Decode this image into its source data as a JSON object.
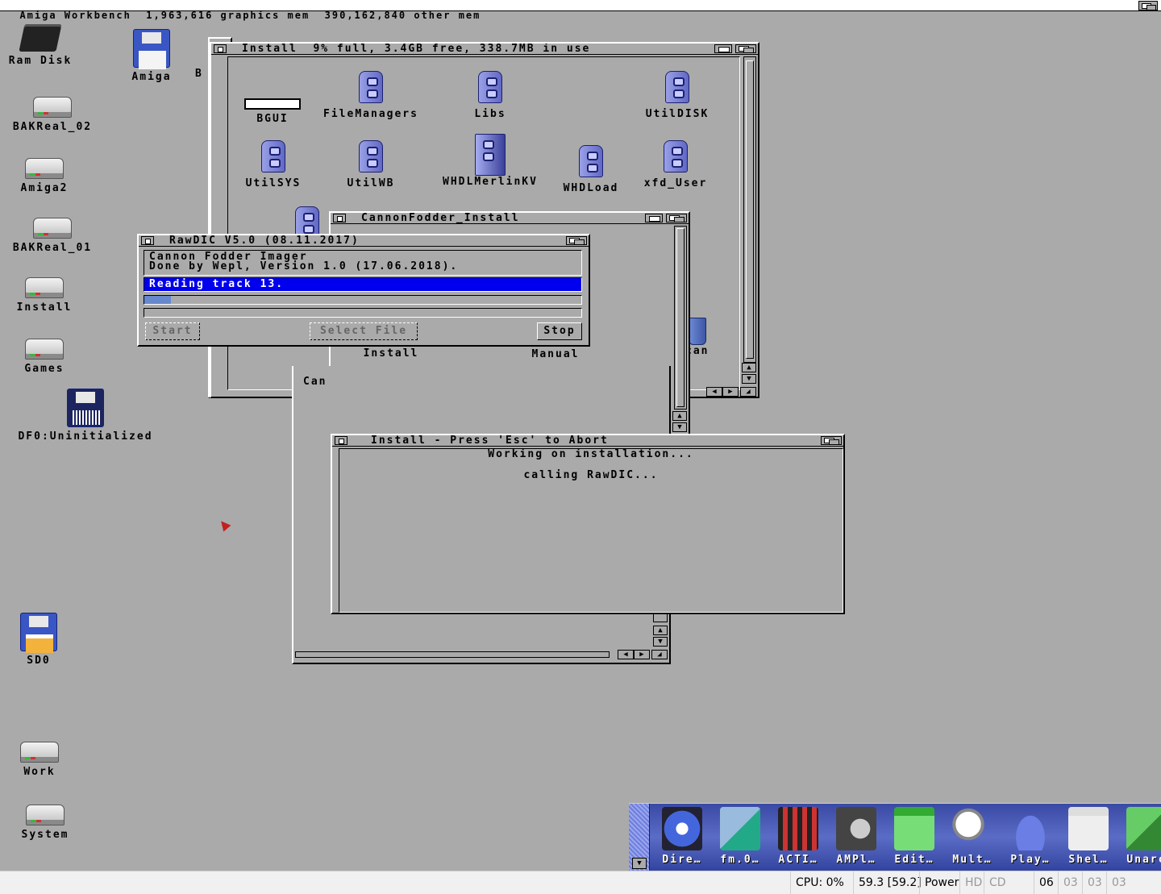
{
  "screen": {
    "title": "Amiga Workbench  1,963,616 graphics mem  390,162,840 other mem"
  },
  "desktop_icons": [
    {
      "label": "Ram Disk"
    },
    {
      "label": "Amiga"
    },
    {
      "label": "BAKReal_02"
    },
    {
      "label": "Amiga2"
    },
    {
      "label": "BAKReal_01"
    },
    {
      "label": "Install"
    },
    {
      "label": "Games"
    },
    {
      "label": "DF0:Uninitialized"
    },
    {
      "label": "SD0"
    },
    {
      "label": "Work"
    },
    {
      "label": "System"
    }
  ],
  "partial_icon_label": "B",
  "install_window": {
    "title": "Install  9% full, 3.4GB free, 338.7MB in use",
    "items": [
      {
        "label": "BGUI"
      },
      {
        "label": "FileManagers"
      },
      {
        "label": "Libs"
      },
      {
        "label": "UtilDISK"
      },
      {
        "label": "UtilSYS"
      },
      {
        "label": "UtilWB"
      },
      {
        "label": "WHDLMerlinKV"
      },
      {
        "label": "WHDLoad"
      },
      {
        "label": "xfd_User"
      }
    ],
    "partial_trashcan": "can"
  },
  "cannonfodder_window": {
    "title": "CannonFodder_Install",
    "items": [
      {
        "label": "Install"
      },
      {
        "label": "Manual"
      }
    ],
    "partial_label": "Can"
  },
  "rawdic_window": {
    "title": "RawDIC V5.0 (08.11.2017)",
    "info_line1": "Cannon Fodder Imager",
    "info_line2": "Done by Wepl, Version 1.0 (17.06.2018).",
    "status": "Reading track 13.",
    "progress": 0.06,
    "buttons": {
      "start": "Start",
      "select_file": "Select File",
      "stop": "Stop"
    }
  },
  "installer_window": {
    "title": "Install - Press 'Esc' to Abort",
    "line1": "Working on installation...",
    "line2": "calling RawDIC..."
  },
  "dock": {
    "items": [
      {
        "label": "Dire…",
        "icon": "radar-icon"
      },
      {
        "label": "fm.0…",
        "icon": "file-manager-icon"
      },
      {
        "label": "ACTI…",
        "icon": "film-strip-icon"
      },
      {
        "label": "AMPl…",
        "icon": "speaker-icon"
      },
      {
        "label": "Edit…",
        "icon": "notepad-icon"
      },
      {
        "label": "Mult…",
        "icon": "magnifier-icon"
      },
      {
        "label": "Play…",
        "icon": "disc-player-icon"
      },
      {
        "label": "Shel…",
        "icon": "shell-window-icon"
      },
      {
        "label": "Unarc",
        "icon": "cube-icon"
      }
    ]
  },
  "statusbar": {
    "cpu": "CPU: 0%",
    "fps": "59.3 [59.2]",
    "power": "Power",
    "hd": "HD",
    "cd": "CD",
    "df0": "06",
    "df1": "03",
    "df2": "03",
    "df3": "03"
  },
  "colors": {
    "workbench_gray": "#aaaaaa",
    "highlight_blue": "#0000ee",
    "progress_blue": "#6688cc",
    "dock_blue": "#4a5ab8"
  }
}
